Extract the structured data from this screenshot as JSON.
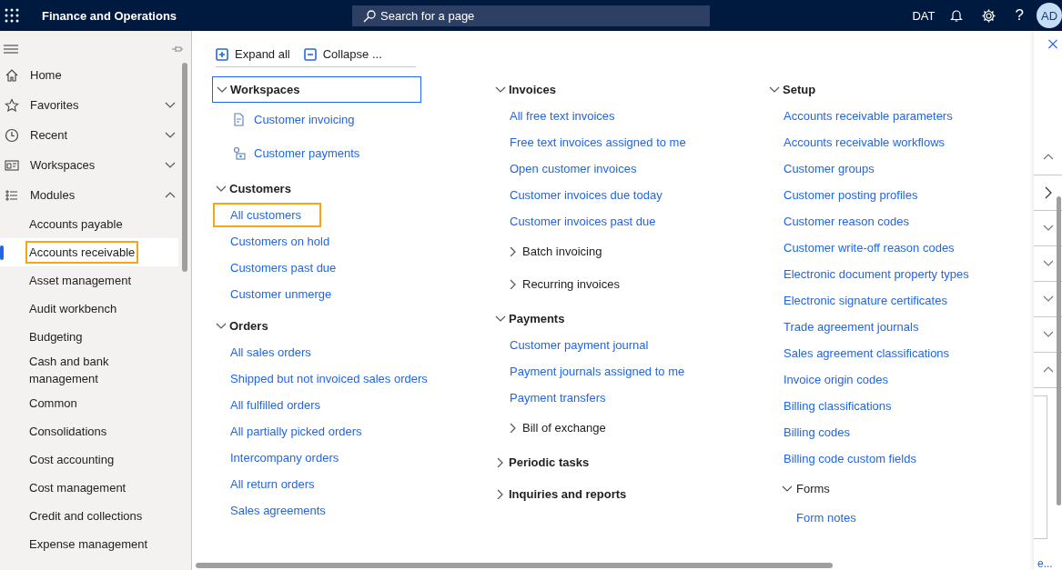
{
  "app_bar": {
    "title": "Finance and Operations",
    "search": {
      "placeholder": "Search for a page"
    },
    "company": "DAT",
    "help": "?",
    "avatar": "AD"
  },
  "nav": {
    "items": [
      {
        "label": "Home",
        "kind": "home"
      },
      {
        "label": "Favorites",
        "kind": "favorites",
        "expanded": false
      },
      {
        "label": "Recent",
        "kind": "recent",
        "expanded": false
      },
      {
        "label": "Workspaces",
        "kind": "workspaces",
        "expanded": false
      },
      {
        "label": "Modules",
        "kind": "modules",
        "expanded": true
      }
    ],
    "modules": [
      {
        "label": "Accounts payable",
        "selected": false,
        "highlighted": false
      },
      {
        "label": "Accounts receivable",
        "selected": true,
        "highlighted": true
      },
      {
        "label": "Asset management",
        "selected": false,
        "highlighted": false
      },
      {
        "label": "Audit workbench",
        "selected": false,
        "highlighted": false
      },
      {
        "label": "Budgeting",
        "selected": false,
        "highlighted": false
      },
      {
        "label": "Cash and bank management",
        "selected": false,
        "highlighted": false
      },
      {
        "label": "Common",
        "selected": false,
        "highlighted": false
      },
      {
        "label": "Consolidations",
        "selected": false,
        "highlighted": false
      },
      {
        "label": "Cost accounting",
        "selected": false,
        "highlighted": false
      },
      {
        "label": "Cost management",
        "selected": false,
        "highlighted": false
      },
      {
        "label": "Credit and collections",
        "selected": false,
        "highlighted": false
      },
      {
        "label": "Expense management",
        "selected": false,
        "highlighted": false
      }
    ]
  },
  "toolbar": [
    {
      "label": "Expand all",
      "kind": "expand"
    },
    {
      "label": "Collapse ...",
      "kind": "collapse"
    }
  ],
  "columns": [
    [
      {
        "title": "Workspaces",
        "expanded": true,
        "focused": true,
        "items": [
          {
            "kind": "workspace_link",
            "label": "Customer invoicing"
          },
          {
            "kind": "workspace_link",
            "label": "Customer payments"
          }
        ]
      },
      {
        "title": "Customers",
        "expanded": true,
        "focused": false,
        "items": [
          {
            "kind": "link",
            "label": "All customers",
            "highlighted": true
          },
          {
            "kind": "link",
            "label": "Customers on hold",
            "highlighted": false
          },
          {
            "kind": "link",
            "label": "Customers past due",
            "highlighted": false
          },
          {
            "kind": "link",
            "label": "Customer unmerge",
            "highlighted": false
          }
        ]
      },
      {
        "title": "Orders",
        "expanded": true,
        "focused": false,
        "items": [
          {
            "kind": "link",
            "label": "All sales orders"
          },
          {
            "kind": "link",
            "label": "Shipped but not invoiced sales orders"
          },
          {
            "kind": "link",
            "label": "All fulfilled orders"
          },
          {
            "kind": "link",
            "label": "All partially picked orders"
          },
          {
            "kind": "link",
            "label": "Intercompany orders"
          },
          {
            "kind": "link",
            "label": "All return orders"
          },
          {
            "kind": "link",
            "label": "Sales agreements"
          }
        ]
      }
    ],
    [
      {
        "title": "Invoices",
        "expanded": true,
        "focused": false,
        "items": [
          {
            "kind": "link",
            "label": "All free text invoices"
          },
          {
            "kind": "link",
            "label": "Free text invoices assigned to me"
          },
          {
            "kind": "link",
            "label": "Open customer invoices"
          },
          {
            "kind": "link",
            "label": "Customer invoices due today"
          },
          {
            "kind": "link",
            "label": "Customer invoices past due"
          },
          {
            "kind": "group",
            "title": "Batch invoicing",
            "expanded": false
          },
          {
            "kind": "group",
            "title": "Recurring invoices",
            "expanded": false
          }
        ]
      },
      {
        "title": "Payments",
        "expanded": true,
        "focused": false,
        "items": [
          {
            "kind": "link",
            "label": "Customer payment journal"
          },
          {
            "kind": "link",
            "label": "Payment journals assigned to me"
          },
          {
            "kind": "link",
            "label": "Payment transfers"
          },
          {
            "kind": "group",
            "title": "Bill of exchange",
            "expanded": false
          }
        ]
      },
      {
        "title": "Periodic tasks",
        "expanded": false,
        "focused": false
      },
      {
        "title": "Inquiries and reports",
        "expanded": false,
        "focused": false
      }
    ],
    [
      {
        "title": "Setup",
        "expanded": true,
        "focused": false,
        "items": [
          {
            "kind": "link",
            "label": "Accounts receivable parameters"
          },
          {
            "kind": "link",
            "label": "Accounts receivable workflows"
          },
          {
            "kind": "link",
            "label": "Customer groups"
          },
          {
            "kind": "link",
            "label": "Customer posting profiles"
          },
          {
            "kind": "link",
            "label": "Customer reason codes"
          },
          {
            "kind": "link",
            "label": "Customer write-off reason codes"
          },
          {
            "kind": "link",
            "label": "Electronic document property types"
          },
          {
            "kind": "link",
            "label": "Electronic signature certificates"
          },
          {
            "kind": "link",
            "label": "Trade agreement journals"
          },
          {
            "kind": "link",
            "label": "Sales agreement classifications"
          },
          {
            "kind": "link",
            "label": "Invoice origin codes"
          },
          {
            "kind": "link",
            "label": "Billing classifications"
          },
          {
            "kind": "link",
            "label": "Billing codes"
          },
          {
            "kind": "link",
            "label": "Billing code custom fields"
          },
          {
            "kind": "group",
            "title": "Forms",
            "expanded": true,
            "items": [
              {
                "kind": "link",
                "label": "Form notes"
              }
            ]
          }
        ]
      }
    ]
  ],
  "side_pane": {
    "sections": [
      {
        "expanded": true
      },
      {
        "expanded": false
      },
      {
        "expanded": false
      },
      {
        "expanded": false
      },
      {
        "expanded": false
      },
      {
        "expanded": true
      }
    ],
    "more_link": "e..."
  }
}
